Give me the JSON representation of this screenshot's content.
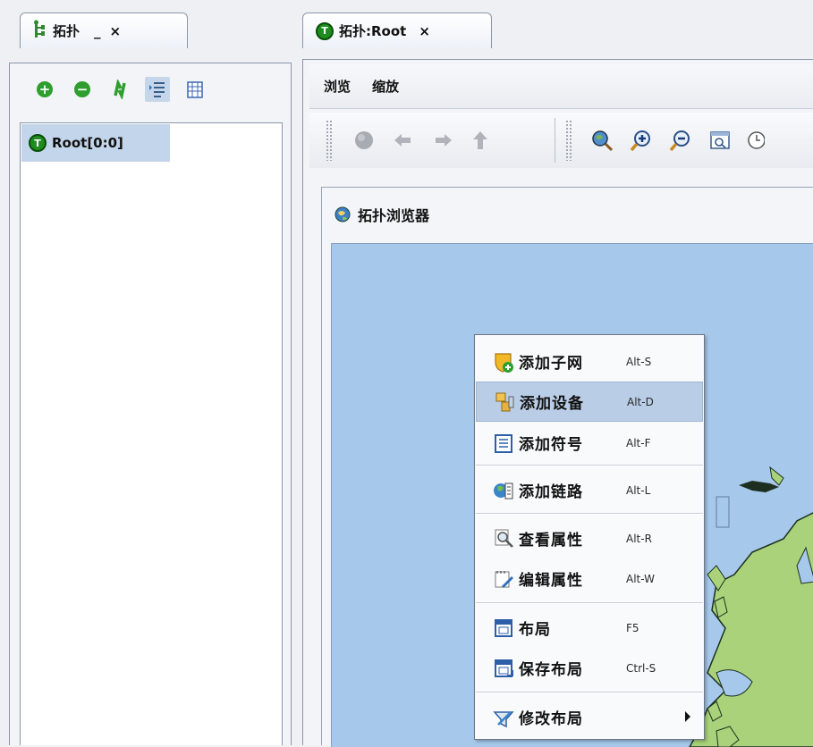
{
  "left_tab": {
    "title": "拓扑",
    "minimize_label": "_",
    "close_label": "×"
  },
  "left_toolbar": {
    "items": [
      {
        "name": "add-icon",
        "color": "#2e9e2e"
      },
      {
        "name": "remove-icon",
        "color": "#2e9e2e"
      },
      {
        "name": "refresh-icon",
        "color": "#2e9e2e"
      },
      {
        "name": "indent-tree-icon",
        "active": true
      },
      {
        "name": "table-icon"
      }
    ]
  },
  "tree": {
    "items": [
      {
        "label": "Root[0:0]",
        "icon": "topology-root-icon"
      }
    ]
  },
  "right_tab": {
    "title": "拓扑:Root",
    "close_label": "×"
  },
  "menubar": {
    "items": [
      "浏览",
      "缩放"
    ]
  },
  "viewer": {
    "title": "拓扑浏览器"
  },
  "context_menu": {
    "items": [
      {
        "label": "添加子网",
        "accel": "Alt-S",
        "icon": "add-subnet-icon"
      },
      {
        "label": "添加设备",
        "accel": "Alt-D",
        "icon": "add-device-icon",
        "highlighted": true
      },
      {
        "label": "添加符号",
        "accel": "Alt-F",
        "icon": "add-symbol-icon"
      },
      {
        "label": "添加链路",
        "accel": "Alt-L",
        "icon": "add-link-icon"
      },
      {
        "label": "查看属性",
        "accel": "Alt-R",
        "icon": "view-properties-icon"
      },
      {
        "label": "编辑属性",
        "accel": "Alt-W",
        "icon": "edit-properties-icon"
      },
      {
        "label": "布局",
        "accel": "F5",
        "icon": "layout-icon"
      },
      {
        "label": "保存布局",
        "accel": "Ctrl-S",
        "icon": "save-layout-icon"
      },
      {
        "label": "修改布局",
        "accel": "",
        "icon": "modify-layout-icon",
        "submenu": true
      }
    ]
  },
  "colors": {
    "map_sea": "#a6c8eb",
    "map_land": "#a9d27a",
    "selection": "#c3d5ea"
  }
}
